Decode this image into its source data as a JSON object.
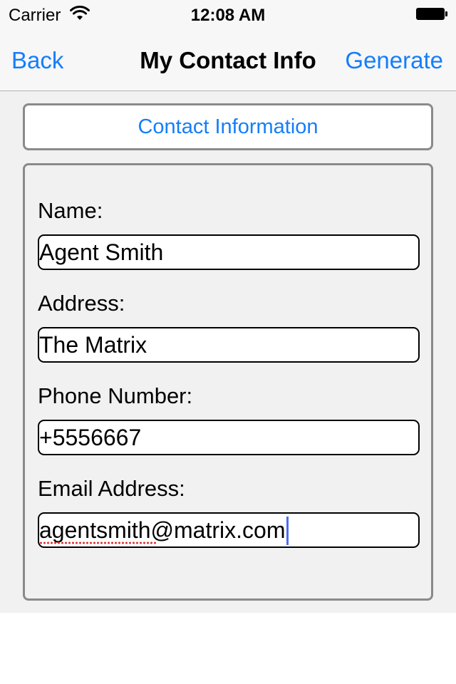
{
  "status_bar": {
    "carrier": "Carrier",
    "time": "12:08 AM",
    "wifi_icon": "wifi-icon",
    "battery_icon": "battery-full-icon"
  },
  "nav": {
    "back_label": "Back",
    "title": "My Contact Info",
    "action_label": "Generate",
    "tint_color": "#147efb"
  },
  "section_button": {
    "label": "Contact Information"
  },
  "form": {
    "fields": [
      {
        "label": "Name:",
        "value": "Agent Smith"
      },
      {
        "label": "Address:",
        "value": "The Matrix"
      },
      {
        "label": "Phone Number:",
        "value": "+5556667"
      },
      {
        "label": "Email Address:",
        "value": "agentsmith@matrix.com",
        "focused": true
      }
    ]
  }
}
